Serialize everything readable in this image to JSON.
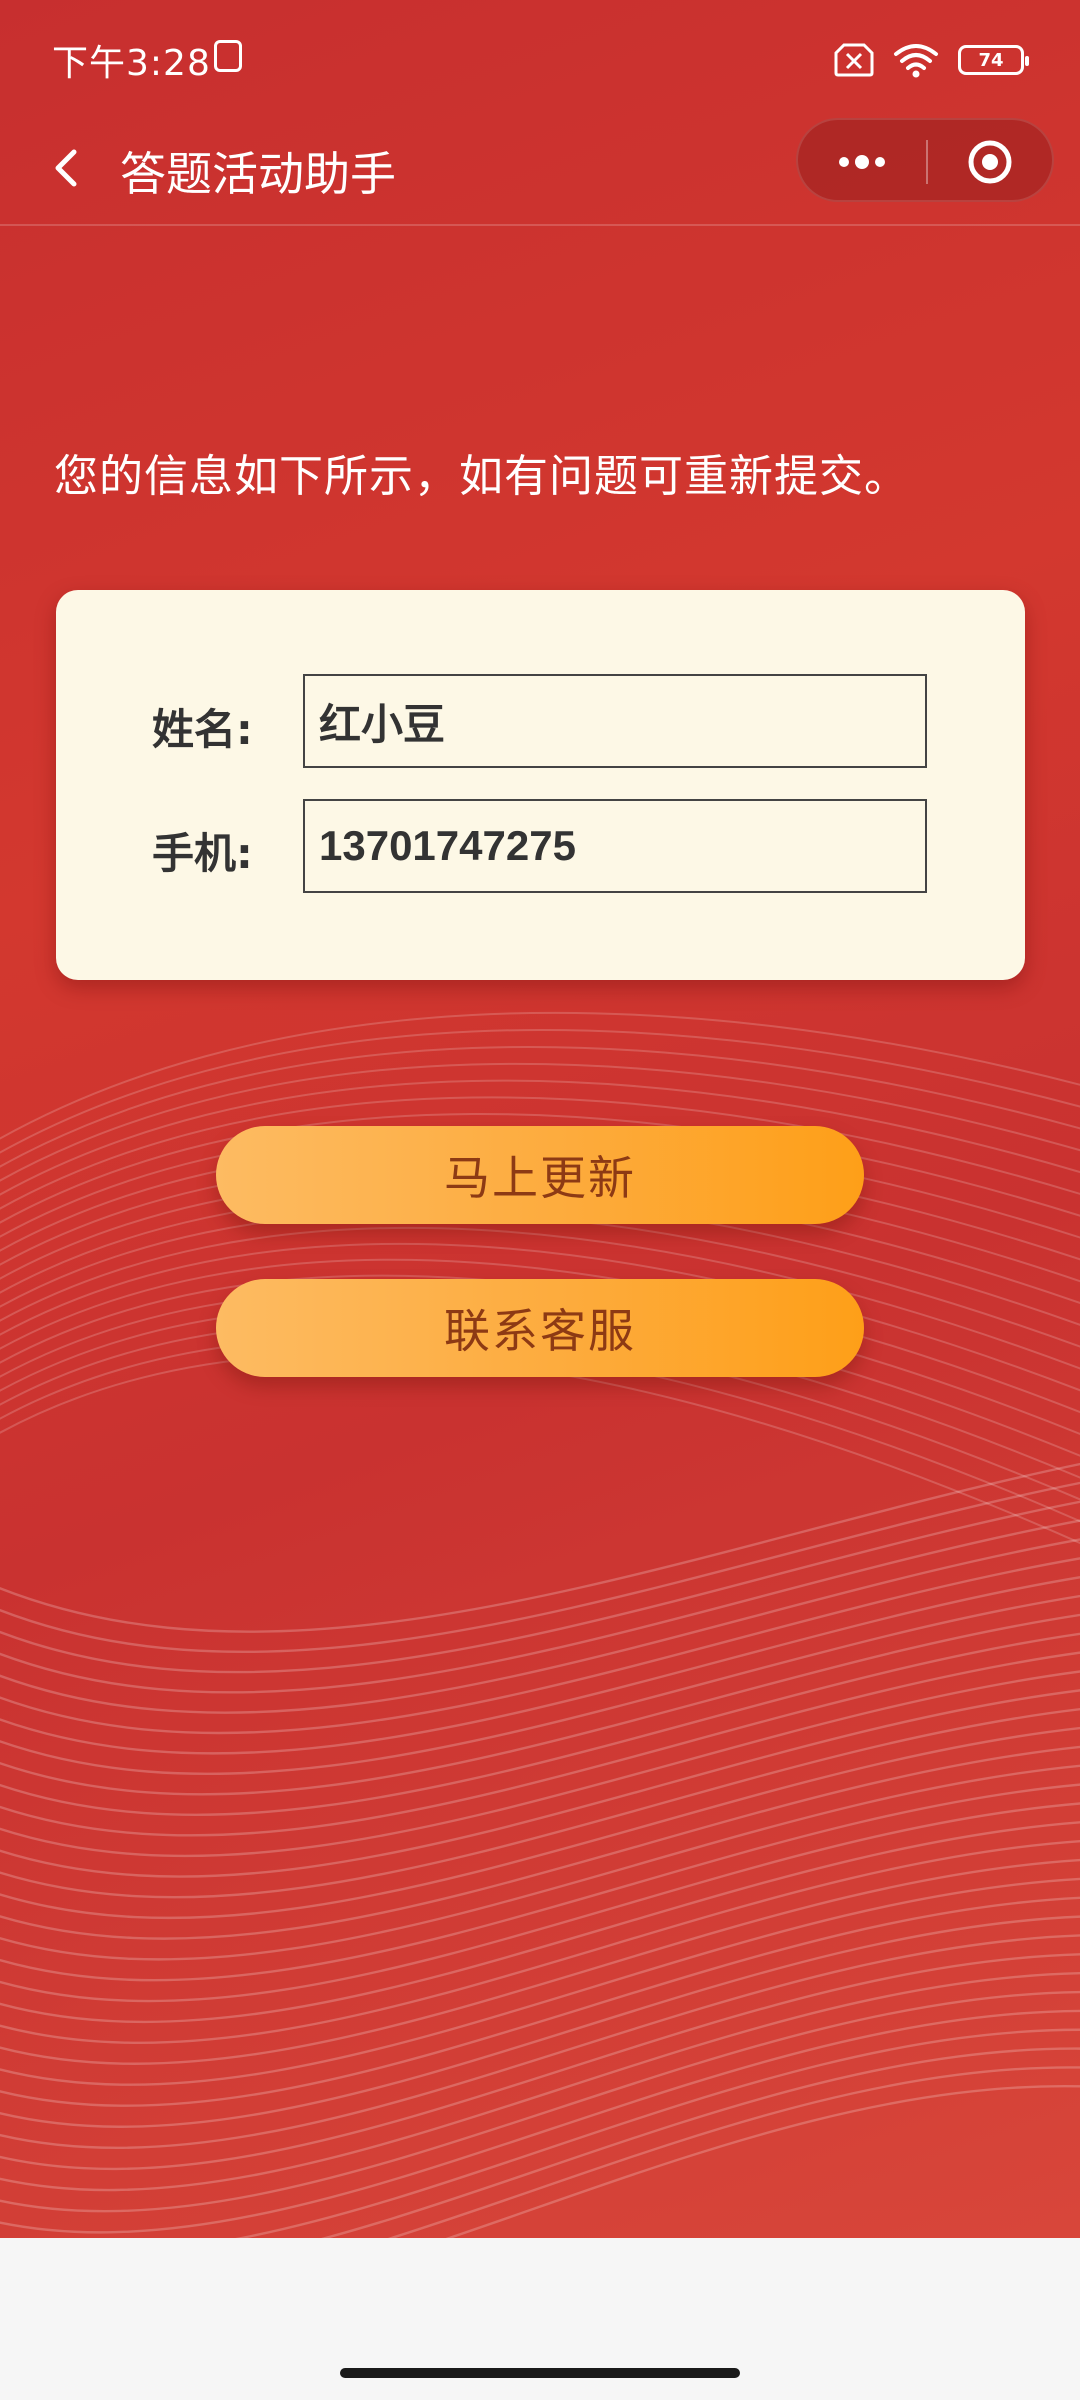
{
  "status_bar": {
    "time": "下午3:28",
    "battery_level": "74",
    "icons": [
      "sim-card-icon",
      "no-sim-icon",
      "wifi-icon",
      "battery-icon"
    ]
  },
  "nav": {
    "title": "答题活动助手",
    "back_icon": "chevron-left-icon",
    "capsule_icons": [
      "more-dots-icon",
      "close-circle-icon"
    ]
  },
  "main": {
    "notice": "您的信息如下所示，如有问题可重新提交。",
    "form": {
      "name_label": "姓名:",
      "name_value": "红小豆",
      "phone_label": "手机:",
      "phone_value": "13701747275"
    },
    "buttons": {
      "update_label": "马上更新",
      "contact_label": "联系客服"
    }
  },
  "colors": {
    "background_red": "#cf3530",
    "card_cream": "#fdf8e6",
    "button_orange": "#fdab3c",
    "button_text": "#8d3a14"
  }
}
